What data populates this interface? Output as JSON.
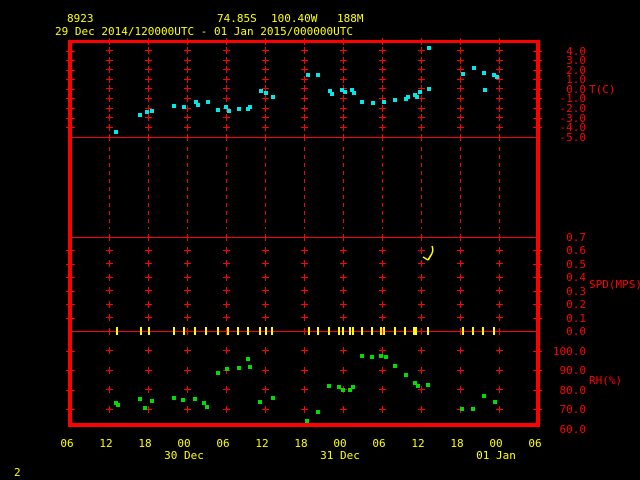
{
  "header": {
    "station_id": "8923",
    "latitude": "74.85S",
    "longitude": "100.40W",
    "elevation": "188M",
    "time_range": "29 Dec 2014/120000UTC - 01 Jan 2015/000000UTC"
  },
  "page_number": "2",
  "colors": {
    "axis": "#ff0000",
    "header_text": "#ffff00",
    "temperature_marker": "#00e8e8",
    "humidity_marker": "#00dd00",
    "wind_marker": "#ffff00",
    "background": "#000000"
  },
  "axes": {
    "x": {
      "hour_labels": [
        "06",
        "12",
        "18",
        "00",
        "06",
        "12",
        "18",
        "00",
        "06",
        "12",
        "18",
        "00",
        "06"
      ],
      "hours_per_label": 6,
      "start": "29 Dec 2014 06UTC",
      "end": "01 Jan 2015 06UTC",
      "dates": [
        {
          "label": "30 Dec",
          "t": 18
        },
        {
          "label": "31 Dec",
          "t": 42
        },
        {
          "label": "01 Jan",
          "t": 66
        }
      ]
    },
    "temperature": {
      "name": "T(C)",
      "tick_labels": [
        "4.0",
        "3.0",
        "2.0",
        "1.0",
        "0.0",
        "-1.0",
        "-2.0",
        "-3.0",
        "-4.0",
        "-5.0"
      ],
      "tick_values": [
        4,
        3,
        2,
        1,
        0,
        -1,
        -2,
        -3,
        -4,
        -5
      ]
    },
    "wind_speed": {
      "name": "SPD(MPS)",
      "tick_labels": [
        "0.7",
        "0.6",
        "0.5",
        "0.4",
        "0.3",
        "0.2",
        "0.1",
        "0.0"
      ],
      "tick_values": [
        0.7,
        0.6,
        0.5,
        0.4,
        0.3,
        0.2,
        0.1,
        0
      ]
    },
    "humidity": {
      "name": "RH(%)",
      "tick_labels": [
        "100.0",
        "90.0",
        "80.0",
        "70.0",
        "60.0"
      ],
      "tick_values": [
        100,
        90,
        80,
        70,
        60
      ]
    }
  },
  "chart_data": [
    {
      "type": "scatter",
      "series_name": "temperature",
      "unit": "C",
      "x_unit": "hours since 29 Dec 2014 06UTC",
      "ylim": [
        -5,
        5
      ],
      "points": [
        [
          7.1,
          -4.5
        ],
        [
          10.8,
          -2.7
        ],
        [
          11.8,
          -2.4
        ],
        [
          12.6,
          -2.3
        ],
        [
          16.0,
          -1.8
        ],
        [
          17.5,
          -1.9
        ],
        [
          19.4,
          -1.4
        ],
        [
          19.7,
          -1.7
        ],
        [
          21.2,
          -1.4
        ],
        [
          22.8,
          -2.2
        ],
        [
          24.0,
          -1.9
        ],
        [
          24.5,
          -2.3
        ],
        [
          26.0,
          -2.1
        ],
        [
          27.4,
          -2.1
        ],
        [
          27.7,
          -1.9
        ],
        [
          29.4,
          -0.2
        ],
        [
          30.2,
          -0.4
        ],
        [
          31.2,
          -0.8
        ],
        [
          36.6,
          1.5
        ],
        [
          38.2,
          1.5
        ],
        [
          40.0,
          -0.2
        ],
        [
          40.3,
          -0.5
        ],
        [
          41.8,
          -0.1
        ],
        [
          42.3,
          -0.3
        ],
        [
          43.4,
          -0.1
        ],
        [
          43.7,
          -0.4
        ],
        [
          44.9,
          -1.4
        ],
        [
          46.6,
          -1.5
        ],
        [
          48.3,
          -1.4
        ],
        [
          50.0,
          -1.2
        ],
        [
          51.7,
          -1.1
        ],
        [
          52.0,
          -0.9
        ],
        [
          53.1,
          -0.6
        ],
        [
          53.4,
          -0.9
        ],
        [
          53.8,
          -0.3
        ],
        [
          55.3,
          4.3
        ],
        [
          55.2,
          0.0
        ],
        [
          60.5,
          1.6
        ],
        [
          62.2,
          2.2
        ],
        [
          63.7,
          1.7
        ],
        [
          63.8,
          -0.1
        ],
        [
          65.2,
          1.5
        ],
        [
          65.7,
          1.2
        ]
      ]
    },
    {
      "type": "scatter",
      "series_name": "wind_speed",
      "unit": "MPS",
      "x_unit": "hours since 29 Dec 2014 06UTC",
      "ylim": [
        0,
        0.7
      ],
      "points": [
        [
          7.2,
          0.0
        ],
        [
          10.9,
          0.0
        ],
        [
          12.2,
          0.0
        ],
        [
          16.0,
          0.0
        ],
        [
          17.6,
          0.0
        ],
        [
          19.2,
          0.0
        ],
        [
          20.9,
          0.0
        ],
        [
          22.7,
          0.0
        ],
        [
          24.3,
          0.0
        ],
        [
          25.8,
          0.0
        ],
        [
          27.4,
          0.0
        ],
        [
          29.3,
          0.0
        ],
        [
          30.2,
          0.0
        ],
        [
          31.1,
          0.0
        ],
        [
          36.7,
          0.0
        ],
        [
          38.2,
          0.0
        ],
        [
          39.9,
          0.0
        ],
        [
          41.4,
          0.0
        ],
        [
          42.0,
          0.0
        ],
        [
          43.1,
          0.0
        ],
        [
          43.5,
          0.0
        ],
        [
          44.9,
          0.0
        ],
        [
          46.4,
          0.0
        ],
        [
          47.9,
          0.0
        ],
        [
          48.3,
          0.0
        ],
        [
          50.0,
          0.0
        ],
        [
          51.5,
          0.0
        ],
        [
          52.9,
          0.0
        ],
        [
          53.3,
          0.0
        ],
        [
          55.1,
          0.0
        ],
        [
          60.4,
          0.0
        ],
        [
          62.0,
          0.0
        ],
        [
          63.6,
          0.0
        ],
        [
          65.3,
          0.0
        ]
      ],
      "wind_arrow": {
        "t": 55.2,
        "v": 0.57,
        "symbol": "down-arrow"
      }
    },
    {
      "type": "scatter",
      "series_name": "relative_humidity",
      "unit": "%",
      "x_unit": "hours since 29 Dec 2014 06UTC",
      "ylim": [
        60,
        100
      ],
      "points": [
        [
          7.1,
          73.3
        ],
        [
          7.4,
          72.2
        ],
        [
          10.7,
          75.2
        ],
        [
          11.5,
          70.8
        ],
        [
          12.6,
          74.2
        ],
        [
          16.0,
          75.9
        ],
        [
          17.4,
          74.6
        ],
        [
          19.2,
          75.2
        ],
        [
          20.6,
          73.3
        ],
        [
          21.0,
          71.3
        ],
        [
          22.7,
          88.7
        ],
        [
          24.1,
          90.5
        ],
        [
          26.0,
          91.0
        ],
        [
          27.4,
          95.6
        ],
        [
          27.7,
          91.8
        ],
        [
          29.2,
          73.8
        ],
        [
          31.2,
          75.6
        ],
        [
          36.5,
          64.1
        ],
        [
          38.2,
          68.7
        ],
        [
          39.9,
          82.1
        ],
        [
          41.4,
          81.4
        ],
        [
          42.0,
          79.8
        ],
        [
          43.1,
          80.1
        ],
        [
          43.6,
          81.6
        ],
        [
          44.9,
          97.3
        ],
        [
          46.4,
          96.9
        ],
        [
          47.8,
          97.3
        ],
        [
          48.6,
          96.6
        ],
        [
          50.0,
          92.3
        ],
        [
          51.7,
          87.5
        ],
        [
          53.1,
          83.2
        ],
        [
          53.6,
          82.1
        ],
        [
          55.0,
          82.4
        ],
        [
          60.3,
          70.1
        ],
        [
          62.0,
          69.9
        ],
        [
          63.7,
          76.8
        ],
        [
          65.4,
          73.8
        ]
      ]
    }
  ]
}
